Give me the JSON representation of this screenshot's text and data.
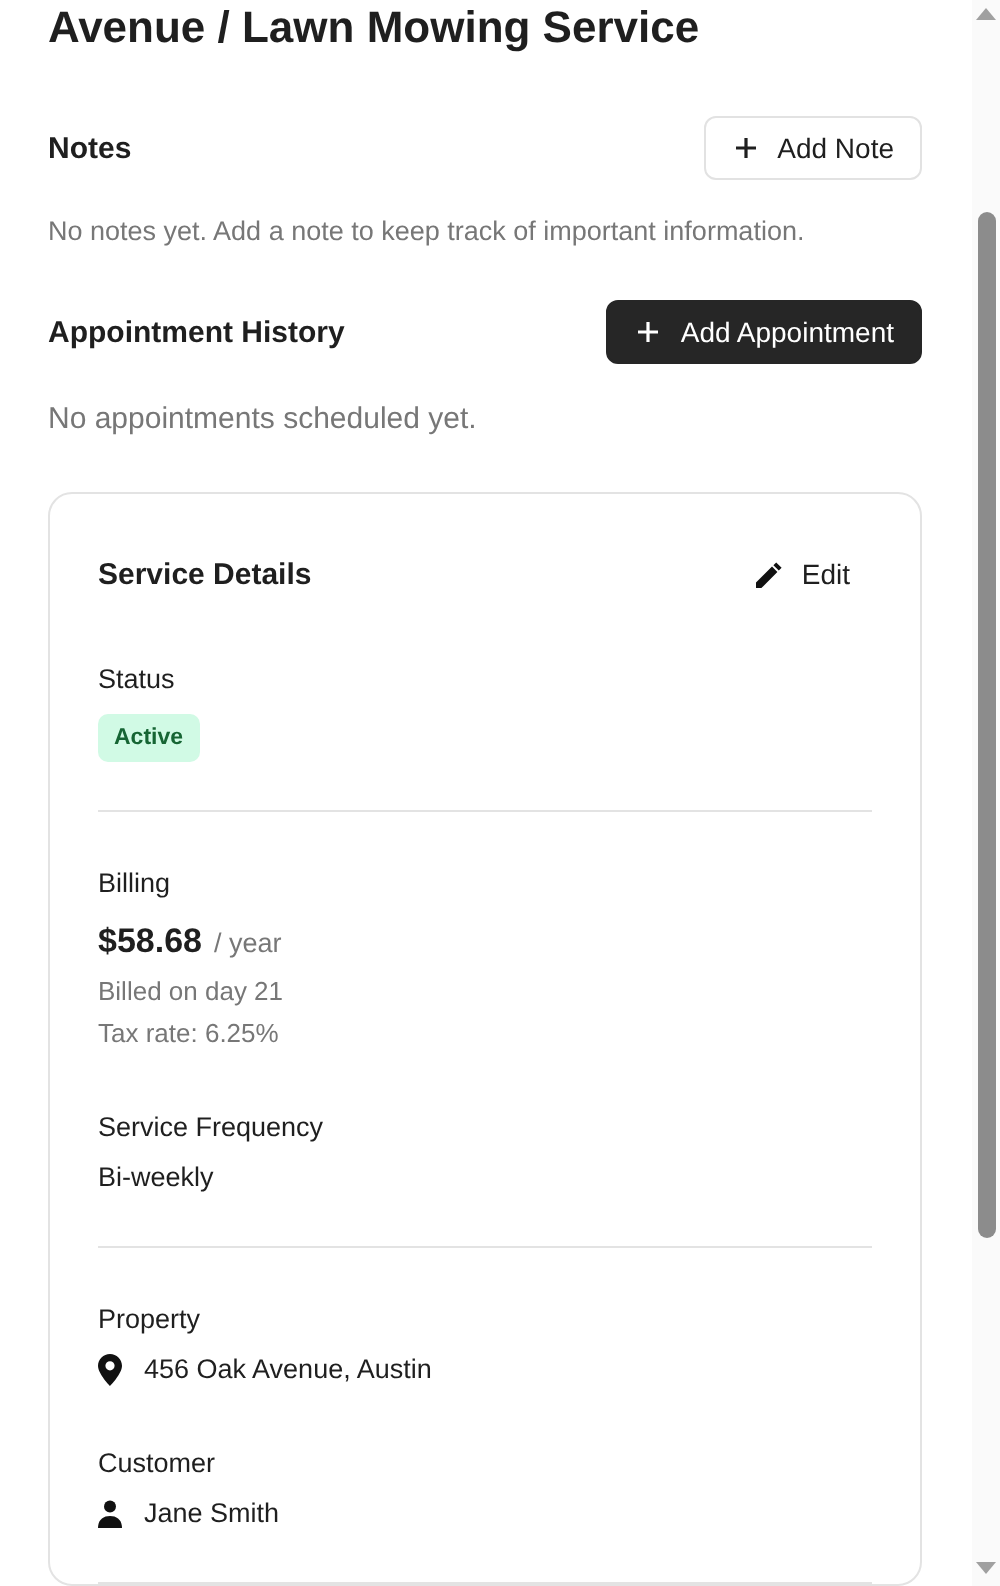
{
  "page_title": "Avenue / Lawn Mowing Service",
  "sections": [
    {
      "title": "Notes",
      "button": {
        "label": "Add Note",
        "kind": "outline"
      },
      "empty_text": "No notes yet. Add a note to keep track of important information."
    },
    {
      "title": "Appointment History",
      "button": {
        "label": "Add Appointment",
        "kind": "primary"
      },
      "empty_text": "No appointments scheduled yet."
    }
  ],
  "service_details": {
    "title": "Service Details",
    "edit_button": "Edit",
    "groups": [
      {
        "fields": [
          {
            "kind": "badge",
            "label": "Status",
            "value": "Active"
          }
        ]
      },
      {
        "fields": [
          {
            "kind": "billing",
            "label": "Billing",
            "amount": "$58.68",
            "period": "/ year",
            "lines": [
              "Billed on day 21",
              "Tax rate: 6.25%"
            ]
          },
          {
            "kind": "text",
            "label": "Service Frequency",
            "value": "Bi-weekly"
          }
        ]
      },
      {
        "fields": [
          {
            "kind": "location",
            "label": "Property",
            "value": "456 Oak Avenue, Austin"
          },
          {
            "kind": "person",
            "label": "Customer",
            "value": "Jane Smith"
          }
        ]
      }
    ]
  }
}
